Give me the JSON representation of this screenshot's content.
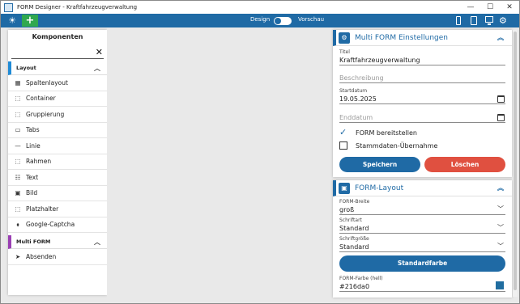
{
  "window": {
    "title": "FORM Designer - Kraftfahrzeugverwaltung",
    "controls": [
      "—",
      "☐",
      "✕"
    ]
  },
  "toolbar": {
    "theme_icon": "sun-icon",
    "add_label": "+",
    "design_label": "Design",
    "preview_label": "Vorschau",
    "mode_switch_on": false,
    "devices": [
      "phone-icon",
      "tablet-icon",
      "desktop-icon"
    ],
    "settings_icon": "gears-icon"
  },
  "sidebar": {
    "title": "Komponenten",
    "search_value": "",
    "clear_label": "✕",
    "sections": [
      {
        "label": "Layout",
        "color": "#1f8bd6",
        "items": [
          {
            "icon": "▦",
            "label": "Spaltenlayout"
          },
          {
            "icon": "⬚",
            "label": "Container"
          },
          {
            "icon": "⬚",
            "label": "Gruppierung"
          },
          {
            "icon": "▭",
            "label": "Tabs"
          },
          {
            "icon": "—",
            "label": "Linie"
          },
          {
            "icon": "⬚",
            "label": "Rahmen"
          },
          {
            "icon": "☷",
            "label": "Text"
          },
          {
            "icon": "▣",
            "label": "Bild"
          },
          {
            "icon": "⬚",
            "label": "Platzhalter"
          },
          {
            "icon": "⬧",
            "label": "Google-Captcha"
          }
        ]
      },
      {
        "label": "Multi FORM",
        "color": "#9a3fb3",
        "items": [
          {
            "icon": "➤",
            "label": "Absenden"
          }
        ]
      }
    ]
  },
  "settings_panel": {
    "title": "Multi FORM Einstellungen",
    "titel_label": "Titel",
    "titel_value": "Kraftfahrzeugverwaltung",
    "beschreibung_placeholder": "Beschreibung",
    "startdatum_label": "Startdatum",
    "startdatum_value": "19.05.2025",
    "enddatum_placeholder": "Enddatum",
    "checkbox_publish_label": "FORM bereitstellen",
    "checkbox_publish_checked": true,
    "checkbox_masterdata_label": "Stammdaten-Übernahme",
    "checkbox_masterdata_checked": false,
    "save_label": "Speichern",
    "delete_label": "Löschen"
  },
  "layout_panel": {
    "title": "FORM-Layout",
    "width_label": "FORM-Breite",
    "width_value": "groß",
    "font_label": "Schriftart",
    "font_value": "Standard",
    "fontsize_label": "Schriftgröße",
    "fontsize_value": "Standard",
    "default_color_label": "Standardfarbe",
    "color_label": "FORM-Farbe (hell)",
    "color_value": "#216da0"
  }
}
